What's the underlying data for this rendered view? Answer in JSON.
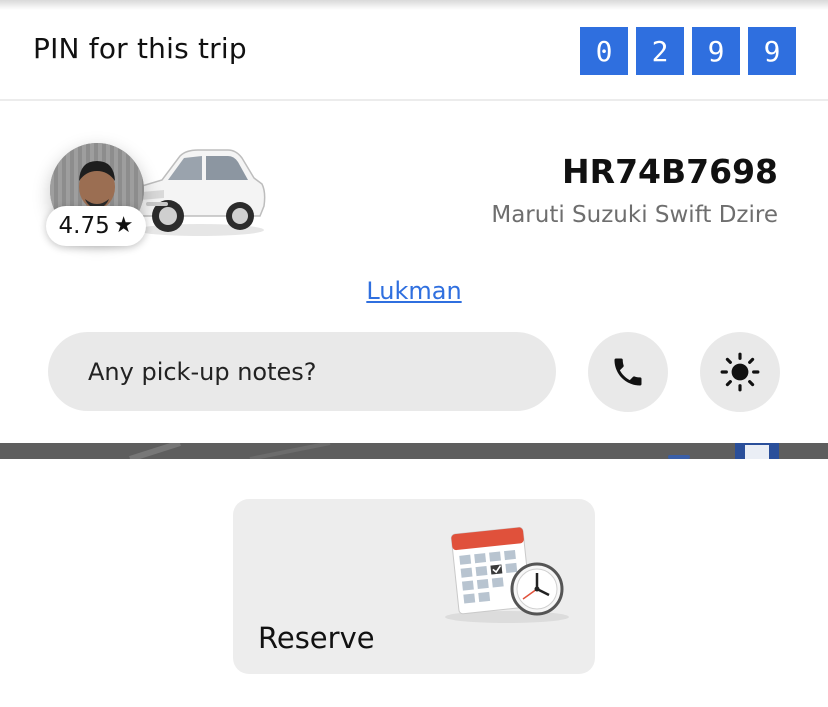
{
  "pin": {
    "label": "PIN for this trip",
    "digits": [
      "0",
      "2",
      "9",
      "9"
    ],
    "digit_color": "#2f6fdf"
  },
  "driver": {
    "rating": "4.75",
    "rating_icon": "star-icon",
    "name": "Lukman"
  },
  "vehicle": {
    "plate": "HR74B7698",
    "model": "Maruti Suzuki Swift Dzire"
  },
  "notes": {
    "placeholder": "Any pick-up notes?"
  },
  "actions": {
    "call_icon": "phone-icon",
    "light_icon": "brightness-icon"
  },
  "reserve": {
    "label": "Reserve",
    "icon": "calendar-clock-icon"
  },
  "colors": {
    "accent": "#2f6fdf",
    "chip_bg": "#e9e9e9",
    "card_bg": "#ededed"
  }
}
